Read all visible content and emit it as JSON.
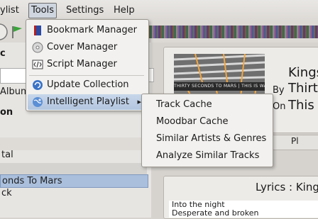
{
  "menubar": {
    "items": [
      {
        "label": "ylist"
      },
      {
        "label": "Tools"
      },
      {
        "label": "Settings"
      },
      {
        "label": "Help"
      }
    ]
  },
  "left": {
    "search_label": "c",
    "album_label": "Album",
    "section_label": "on",
    "row_tal": "tal",
    "row_selected": "onds To Mars",
    "row_ck": "ck"
  },
  "info": {
    "title_partial": "Kings",
    "by_label": "By",
    "artist_partial": "Thirty",
    "on_label": "On",
    "album_partial": "This",
    "tab_label": "Pl",
    "album_art_text": "THIRTY SECONDS TO MARS | THIS IS WAR"
  },
  "lyrics": {
    "header": "Lyrics : Kings",
    "lines": [
      "Into the night",
      "Desperate and broken"
    ]
  },
  "tools_menu": {
    "items": [
      {
        "label": "Bookmark Manager",
        "icon": "bookmark-icon"
      },
      {
        "label": "Cover Manager",
        "icon": "cd-icon"
      },
      {
        "label": "Script Manager",
        "icon": "script-icon"
      },
      {
        "label": "Update Collection",
        "icon": "refresh-icon"
      },
      {
        "label": "Intelligent Playlist",
        "icon": "globe-icon"
      }
    ]
  },
  "sub_menu": {
    "items": [
      {
        "label": "Track Cache"
      },
      {
        "label": "Moodbar Cache"
      },
      {
        "label": "Similar Artists & Genres"
      },
      {
        "label": "Analyze Similar Tracks"
      }
    ]
  },
  "colors": {
    "menu_highlight": "#b3c6df",
    "selected_row": "#a9bfdc"
  }
}
